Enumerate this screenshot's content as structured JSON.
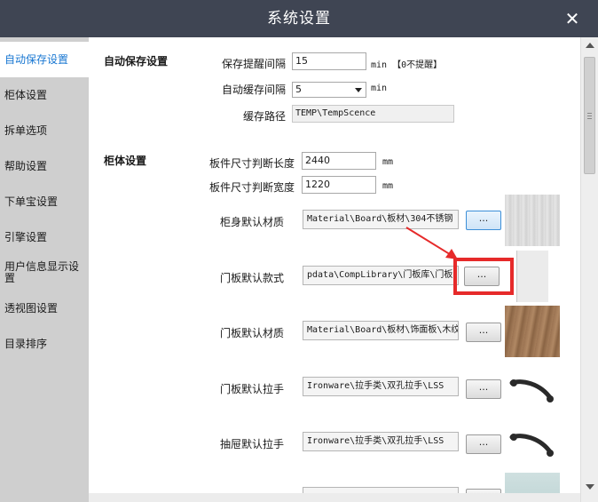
{
  "window": {
    "title": "系统设置",
    "close_glyph": "✕"
  },
  "sidebar": {
    "items": [
      {
        "label": "自动保存设置"
      },
      {
        "label": "柜体设置"
      },
      {
        "label": "拆单选项"
      },
      {
        "label": "帮助设置"
      },
      {
        "label": "下单宝设置"
      },
      {
        "label": "引擎设置"
      },
      {
        "label": "用户信息显示设置"
      },
      {
        "label": "透视图设置"
      },
      {
        "label": "目录排序"
      }
    ]
  },
  "autosave": {
    "section_title": "自动保存设置",
    "reminder_label": "保存提醒间隔",
    "reminder_value": "15",
    "reminder_unit": "min 【0不提醒】",
    "cache_label": "自动缓存间隔",
    "cache_value": "5",
    "cache_unit": "min",
    "path_label": "缓存路径",
    "path_value": "TEMP\\TempScence"
  },
  "cabinet": {
    "section_title": "柜体设置",
    "length_label": "板件尺寸判断长度",
    "length_value": "2440",
    "length_unit": "mm",
    "width_label": "板件尺寸判断宽度",
    "width_value": "1220",
    "width_unit": "mm",
    "rows": [
      {
        "label": "柜身默认材质",
        "path": "Material\\Board\\板材\\304不锈钢",
        "button": "...",
        "swatch": "brushed-metal"
      },
      {
        "label": "门板默认款式",
        "path": "pdata\\CompLibrary\\门板库\\门板",
        "button": "...",
        "swatch": "door-panel"
      },
      {
        "label": "门板默认材质",
        "path": "Material\\Board\\板材\\饰面板\\木纹",
        "button": "...",
        "swatch": "wood-grain"
      },
      {
        "label": "门板默认拉手",
        "path": "Ironware\\拉手类\\双孔拉手\\LSS",
        "button": "...",
        "swatch": "handle-icon"
      },
      {
        "label": "抽屉默认拉手",
        "path": "Ironware\\拉手类\\双孔拉手\\LSS",
        "button": "...",
        "swatch": "handle-icon"
      }
    ]
  },
  "colors": {
    "titlebar": "#3f4553",
    "sidebar": "#cfcfcf",
    "active_nav_text": "#1877d2",
    "highlight": "#e62a2a"
  }
}
